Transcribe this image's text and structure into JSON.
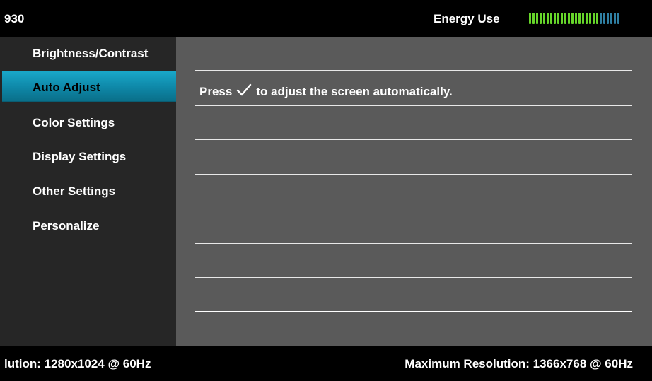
{
  "header": {
    "model_fragment": "930",
    "energy_label": "Energy Use",
    "energy_level": 0.77,
    "energy_segments_total": 26,
    "colors": {
      "energy_on": "#66d52a",
      "energy_off": "#2f7fa3"
    }
  },
  "menu": {
    "items": [
      {
        "label": "Brightness/Contrast",
        "selected": false
      },
      {
        "label": "Auto Adjust",
        "selected": true
      },
      {
        "label": "Color Settings",
        "selected": false
      },
      {
        "label": "Display Settings",
        "selected": false
      },
      {
        "label": "Other Settings",
        "selected": false
      },
      {
        "label": "Personalize",
        "selected": false
      }
    ],
    "colors": {
      "selected": "#0e87a7",
      "background": "#262626"
    }
  },
  "content": {
    "hint_prefix": "Press",
    "hint_icon": "checkmark-icon",
    "hint_suffix": "to adjust the screen automatically."
  },
  "footer": {
    "current_resolution": "lution: 1280x1024 @ 60Hz",
    "maximum_resolution": "Maximum Resolution: 1366x768 @ 60Hz"
  }
}
